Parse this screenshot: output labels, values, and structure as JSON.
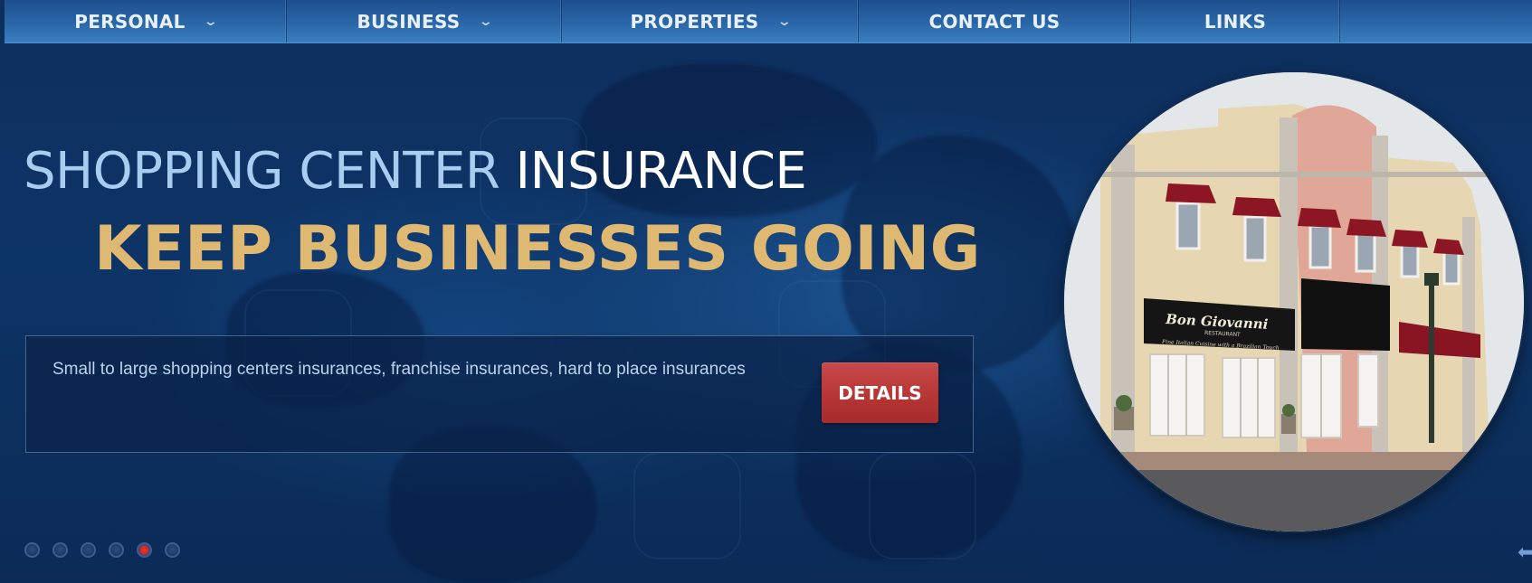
{
  "nav": {
    "items": [
      {
        "label": "PERSONAL",
        "has_dropdown": true
      },
      {
        "label": "BUSINESS",
        "has_dropdown": true
      },
      {
        "label": "PROPERTIES",
        "has_dropdown": true
      },
      {
        "label": "CONTACT US",
        "has_dropdown": false
      },
      {
        "label": "LINKS",
        "has_dropdown": false
      }
    ],
    "dropdown_icon": "chevron-down-icon"
  },
  "hero": {
    "headline_part1": "SHOPPING CENTER",
    "headline_part2": " INSURANCE",
    "tagline": "KEEP BUSINESSES GOING",
    "description": "Small to large shopping centers insurances, franchise insurances, hard to place insurances",
    "details_button": "DETAILS",
    "photo_sign": "Bon Giovanni",
    "photo_sign_sub": "RESTAURANT",
    "photo_awning": "Fine Italian Cuisine with a Brazilian Touch"
  },
  "slider": {
    "slide_count": 6,
    "active_index": 4,
    "next_icon": "arrow-left-icon"
  },
  "colors": {
    "background": "#0c2a57",
    "nav": "#2a67a8",
    "headline_light": "#a9cdf0",
    "tagline": "#dfb872",
    "button": "#b53434",
    "active_dot": "#e23a3a"
  }
}
